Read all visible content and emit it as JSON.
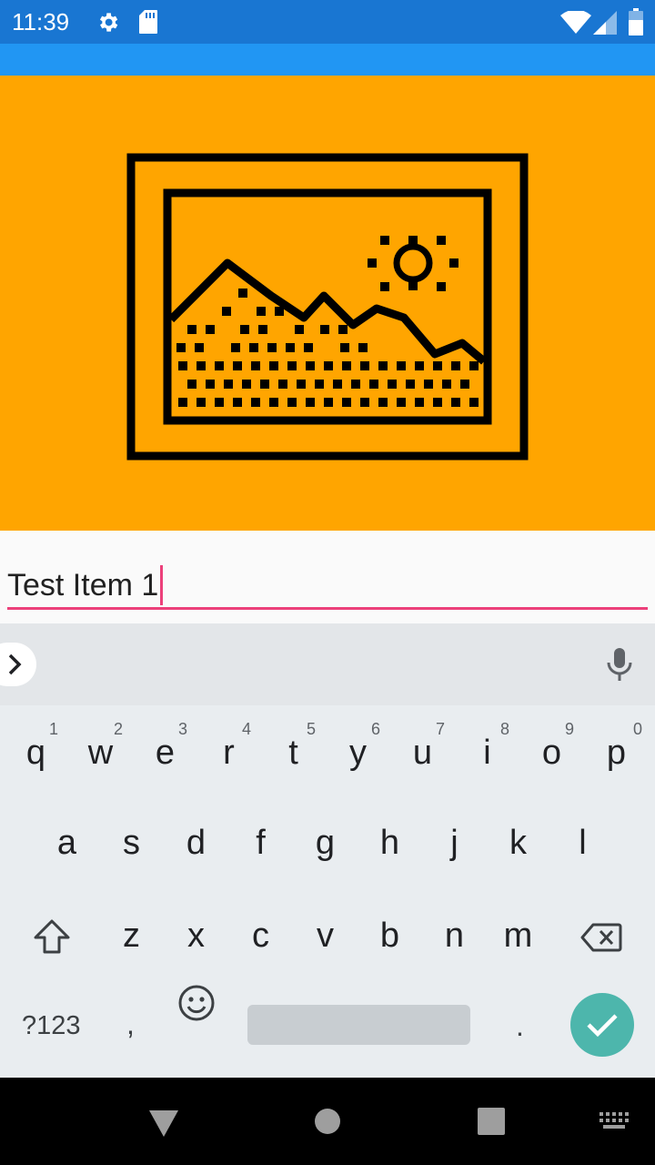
{
  "status_bar": {
    "time": "11:39",
    "icons": [
      "settings-icon",
      "sd-card-icon",
      "wifi-icon",
      "cellular-signal-icon",
      "battery-icon"
    ],
    "background": "#1976d2"
  },
  "app_bar": {
    "background": "#2196f3"
  },
  "hero": {
    "icon": "landscape-image-icon",
    "background": "#ffa500"
  },
  "entry": {
    "value": "Test Item 1",
    "accent": "#ec407a"
  },
  "keyboard": {
    "suggestion_strip": {
      "expand_icon": "chevron-right-icon",
      "mic_icon": "mic-icon"
    },
    "row1": [
      {
        "key": "q",
        "hint": "1"
      },
      {
        "key": "w",
        "hint": "2"
      },
      {
        "key": "e",
        "hint": "3"
      },
      {
        "key": "r",
        "hint": "4"
      },
      {
        "key": "t",
        "hint": "5"
      },
      {
        "key": "y",
        "hint": "6"
      },
      {
        "key": "u",
        "hint": "7"
      },
      {
        "key": "i",
        "hint": "8"
      },
      {
        "key": "o",
        "hint": "9"
      },
      {
        "key": "p",
        "hint": "0"
      }
    ],
    "row2": [
      "a",
      "s",
      "d",
      "f",
      "g",
      "h",
      "j",
      "k",
      "l"
    ],
    "row3": [
      "z",
      "x",
      "c",
      "v",
      "b",
      "n",
      "m"
    ],
    "row4": {
      "symbols_label": "?123",
      "comma": ",",
      "period": "."
    },
    "enter_color": "#4db6ac"
  },
  "nav_bar": {
    "buttons": [
      "back-icon",
      "home-icon",
      "recents-icon",
      "keyboard-switch-icon"
    ]
  }
}
